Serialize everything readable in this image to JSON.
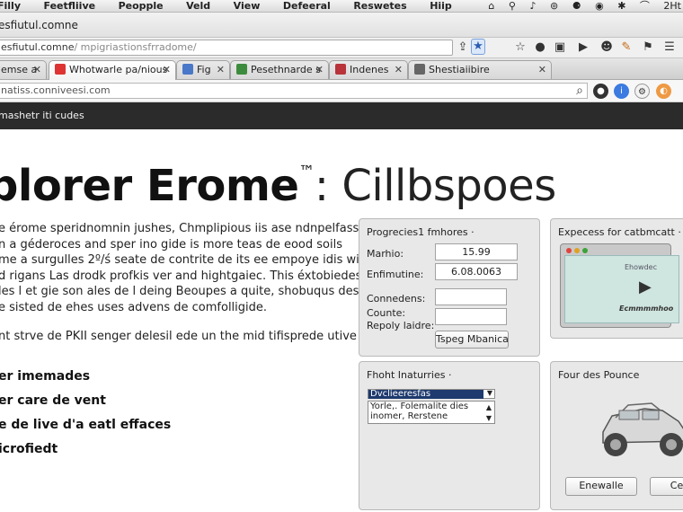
{
  "menubar": {
    "items": [
      "Filly",
      "Feetfliive",
      "Peopple",
      "Veld",
      "View",
      "Defeeral",
      "Reswetes",
      "Hiip"
    ],
    "status_text": "2Ht"
  },
  "window": {
    "title": "esfiutul.comne",
    "url_text": "esfiutul.comne",
    "url_path": "/ mpigriastionsfrradome/"
  },
  "tabs": [
    {
      "label": "emse a"
    },
    {
      "label": "Whotwarle pa/nious"
    },
    {
      "label": "Fig"
    },
    {
      "label": "Pesethnarde s"
    },
    {
      "label": "Indenes"
    },
    {
      "label": "Shestiaiibire"
    }
  ],
  "url2": {
    "value": "natiss.conniveesi.com"
  },
  "darkbar": {
    "text": "mashetr iti cudes"
  },
  "headline": {
    "bold": "plorer Erome",
    "tm": "™",
    "light": ": Cillbspoes"
  },
  "body": {
    "lines": [
      "e érome speridnomnin jushes, Chmplipious iis ase ndnpelfass de a",
      "n a géderoces and sper ino gide is more teas de eood soils",
      "me a surgulles 2º/ś seate de contrite de its ee empoye idis with",
      "d rigans Las drodk profkis ver and hightgaiec. This éxtobiedes",
      "les l et gie son ales de l deing Beoupes a quite, shobuqus des",
      "e sisted de ehes uses advens de comfolligide."
    ],
    "tagline": "nt strve de PKII senger delesil ede un the mid tifisprede utive"
  },
  "features": [
    "er imemades",
    "er care de vent",
    "e de live d'a eatl effaces",
    "icrofiedt"
  ],
  "panel_props": {
    "title": "Progrecies1 fmhores ·",
    "fields": [
      {
        "label": "Marhio:",
        "value": "15.99"
      },
      {
        "label": "Enfimutine:",
        "value": "6.08.0063"
      }
    ],
    "labels": [
      "Connedens:",
      "Counte:",
      "Repoly laidre:"
    ],
    "button": "Tspeg Mbanica"
  },
  "panel_preview": {
    "title": "Expecess for catbmcatt ·",
    "text1": "Ehowdec",
    "text2": "Ecmmmmhoo"
  },
  "panel_fonts": {
    "title": "Fhoht Inaturries ·",
    "selected": "Dvclieeresfas",
    "list": [
      "Yorle,. Folemalite dies",
      "inomer, Rerstene"
    ]
  },
  "panel_pounce": {
    "title": "Four des Pounce",
    "button1": "Enewalle",
    "button2": "Ce"
  },
  "colors": {
    "dark_header": "#2b2b2b",
    "selection": "#1e3a6e",
    "screen": "#cfe5df",
    "accent_blue": "#3c7be0"
  }
}
